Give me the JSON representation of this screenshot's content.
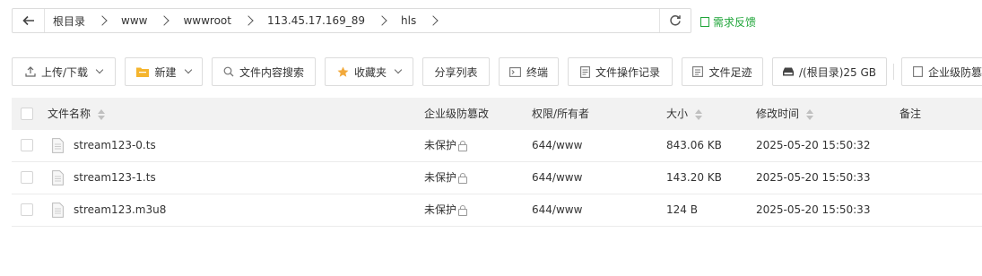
{
  "breadcrumb": {
    "items": [
      "根目录",
      "www",
      "wwwroot",
      "113.45.17.169_89",
      "hls"
    ]
  },
  "feedback_label": "需求反馈",
  "toolbar": {
    "upload_download": "上传/下载",
    "new": "新建",
    "search_content": "文件内容搜索",
    "favorites": "收藏夹",
    "share_list": "分享列表",
    "terminal": "终端",
    "operation_log": "文件操作记录",
    "file_footprint": "文件足迹",
    "disk": "/(根目录)25 GB",
    "enterprise_protect": "企业级防篡"
  },
  "table": {
    "headers": {
      "name": "文件名称",
      "protect": "企业级防篡改",
      "permission": "权限/所有者",
      "size": "大小",
      "modified": "修改时间",
      "note": "备注"
    },
    "rows": [
      {
        "name": "stream123-0.ts",
        "protect": "未保护",
        "permission": "644/www",
        "size": "843.06 KB",
        "modified": "2025-05-20 15:50:32",
        "note": ""
      },
      {
        "name": "stream123-1.ts",
        "protect": "未保护",
        "permission": "644/www",
        "size": "143.20 KB",
        "modified": "2025-05-20 15:50:33",
        "note": ""
      },
      {
        "name": "stream123.m3u8",
        "protect": "未保护",
        "permission": "644/www",
        "size": "124 B",
        "modified": "2025-05-20 15:50:33",
        "note": ""
      }
    ]
  },
  "colors": {
    "accent_green": "#20a53a",
    "folder_yellow": "#f5b52e",
    "star_yellow": "#f2a93b",
    "header_bg": "#f2f2f2"
  },
  "icons": [
    "back-arrow-icon",
    "chevron-right-icon",
    "refresh-icon",
    "feedback-icon",
    "upload-icon",
    "folder-icon",
    "search-icon",
    "star-icon",
    "terminal-icon",
    "log-icon",
    "footprint-icon",
    "disk-icon",
    "shield-icon",
    "file-icon",
    "lock-icon"
  ]
}
